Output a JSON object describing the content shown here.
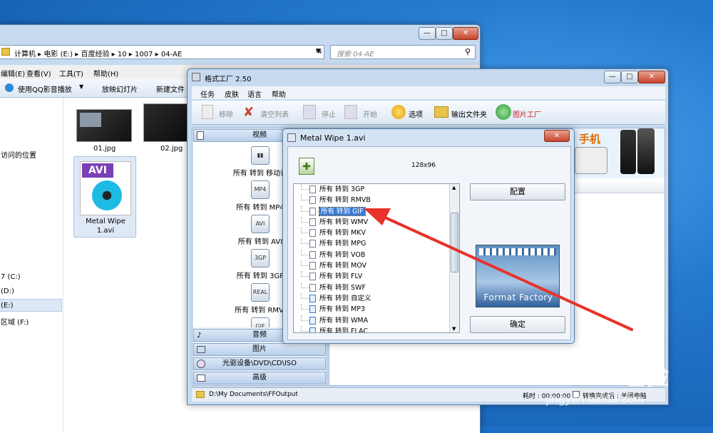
{
  "explorer": {
    "breadcrumb": [
      "计算机",
      "电影 (E:)",
      "百度经验",
      "10",
      "1007",
      "04-AE"
    ],
    "search_placeholder": "搜索 04-AE",
    "menu": [
      "编辑(E)",
      "查看(V)",
      "工具(T)",
      "帮助(H)"
    ],
    "toolbar": [
      "使用QQ影音播放",
      "放映幻灯片",
      "新建文件"
    ],
    "nav": [
      "访问的位置",
      "7 (C:)",
      "(D:)",
      "(E:)",
      "区域 (F:)"
    ],
    "files": [
      "01.jpg",
      "02.jpg",
      "Metal Wipe\n1.avi"
    ],
    "avi_badge": "AVI"
  },
  "ff": {
    "title": "格式工厂 2.50",
    "menu": [
      "任务",
      "皮肤",
      "语言",
      "帮助"
    ],
    "toolbar": [
      "移除",
      "清空列表",
      "停止",
      "开始",
      "选项",
      "输出文件夹",
      "图片工厂"
    ],
    "categories": [
      "视频",
      "音频",
      "图片",
      "光驱设备\\DVD\\CD\\ISO",
      "高级"
    ],
    "video_conversions": [
      "所有 转到 移动设",
      "所有 转到 MP4",
      "所有 转到 AVI",
      "所有 转到 3GP",
      "所有 转到 RMVI"
    ],
    "video_icons": [
      "MP4",
      "AVI",
      "3GP",
      "REAL",
      "GIF"
    ],
    "banner_text": "手机",
    "status": {
      "output_path": "D:\\My Documents\\FFOutput",
      "elapsed": "耗时 : 00:00:00",
      "shutdown_label": "转换完成后 : 关闭电脑"
    }
  },
  "dialog": {
    "title": "Metal Wipe 1.avi",
    "resolution": "128x96",
    "items": [
      "所有 转到 3GP",
      "所有 转到 RMVB",
      "所有 转到 GIF",
      "所有 转到 WMV",
      "所有 转到 MKV",
      "所有 转到 MPG",
      "所有 转到 VOB",
      "所有 转到 MOV",
      "所有 转到 FLV",
      "所有 转到 SWF",
      "所有 转到 自定义",
      "所有 转到 MP3",
      "所有 转到 WMA",
      "所有 转到 FLAC"
    ],
    "selected_item": "所有 转到 GIF",
    "config_button": "配置",
    "ok_button": "确定",
    "logo_text": "Format Factory"
  },
  "watermark": {
    "logo": "Baidu 经验",
    "url": "jingyan.baidu.com"
  },
  "colors": {
    "desktop": "#2479cf",
    "selection": "#3a7bd5",
    "annotation_arrow": "#e8322a"
  }
}
